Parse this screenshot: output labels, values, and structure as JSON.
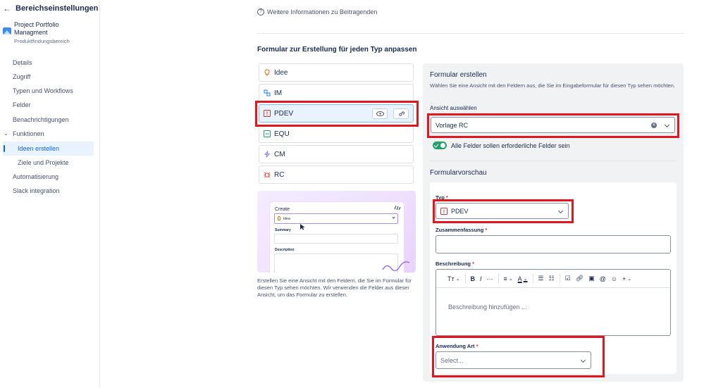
{
  "sidebar": {
    "title": "Bereichseinstellungen",
    "project_name": "Project Portfolio Managment",
    "project_sub": "Produktfindungsbereich",
    "items": [
      {
        "label": "Details"
      },
      {
        "label": "Zugriff"
      },
      {
        "label": "Typen und Workflows"
      },
      {
        "label": "Felder"
      },
      {
        "label": "Benachrichtigungen"
      },
      {
        "label": "Funktionen"
      },
      {
        "label": "Ideen erstellen"
      },
      {
        "label": "Ziele und Projekte"
      },
      {
        "label": "Automatisierung"
      },
      {
        "label": "Slack integration"
      }
    ]
  },
  "main": {
    "info_link": "Weitere Informationen zu Beitragenden",
    "section_title": "Formular zur Erstellung für jeden Typ anpassen",
    "types": [
      {
        "label": "Idee",
        "icon": "lightbulb-icon",
        "color": "#d97008"
      },
      {
        "label": "IM",
        "icon": "nodes-icon",
        "color": "#1d7afc"
      },
      {
        "label": "PDEV",
        "icon": "red-square-icon",
        "color": "#c9372c"
      },
      {
        "label": "EQU",
        "icon": "green-square-icon",
        "color": "#22a06b"
      },
      {
        "label": "CM",
        "icon": "bolt-icon",
        "color": "#8f7ee7"
      },
      {
        "label": "RC",
        "icon": "bug-icon",
        "color": "#e2483d"
      }
    ],
    "illustration": {
      "create": "Create",
      "select_value": "Idea",
      "summary": "Summary",
      "description": "Description"
    },
    "illustration_text": "Erstellen Sie eine Ansicht mit den Feldern, die Sie im Formular für diesen Typ sehen möchten. Wir verwenden die Felder aus dieser Ansicht, um das Formular zu erstellen."
  },
  "panel": {
    "title": "Formular erstellen",
    "subtitle": "Wählen Sie eine Ansicht mit den Feldern aus, die Sie im Eingabeformular für diesen Typ sehen möchten.",
    "view_label": "Ansicht auswählen",
    "view_value": "Vorlage RC",
    "toggle_label": "Alle Felder sollen erforderliche Felder sein",
    "preview_title": "Formularvorschau",
    "fields": {
      "typ_label": "Typ",
      "typ_value": "PDEV",
      "summary_label": "Zusammenfassung",
      "description_label": "Beschreibung",
      "description_placeholder": "Beschreibung hinzufügen ...",
      "art_label": "Anwendung Art",
      "art_placeholder": "Select..."
    },
    "toolbar": {
      "text_style": "Tт",
      "bold": "B",
      "italic": "I",
      "more": "···",
      "align": "≡",
      "color": "A",
      "bullets": "☰",
      "numbers": "☷"
    },
    "required_mark": "*"
  },
  "colors": {
    "accent": "#0c66e4",
    "highlight_red": "#e2161f",
    "toggle_green": "#22a06b"
  }
}
